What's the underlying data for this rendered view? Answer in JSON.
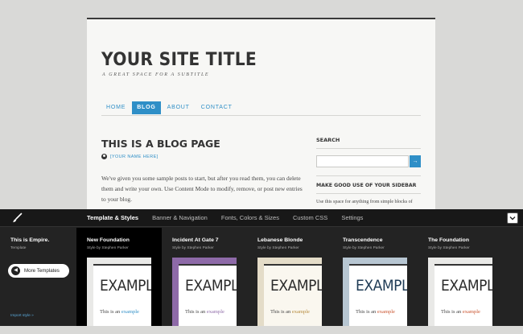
{
  "site": {
    "title": "YOUR SITE TITLE",
    "subtitle": "A GREAT SPACE FOR A SUBTITLE",
    "nav": [
      "HOME",
      "BLOG",
      "ABOUT",
      "CONTACT"
    ],
    "active_nav": "BLOG",
    "post_title": "THIS IS A BLOG PAGE",
    "author": "[YOUR NAME HERE]",
    "post_body": "We've given you some sample posts to start, but after you read them, you can delete them and write your own. Use Content Mode to modify, remove, or post new entries to your blog.",
    "search_label": "SEARCH",
    "search_button": "→",
    "sidebar_heading": "MAKE GOOD USE OF YOUR SIDEBAR",
    "sidebar_text": "Use this space for anything from simple blocks of"
  },
  "editor": {
    "tabs": [
      "Template & Styles",
      "Banner & Navigation",
      "Fonts, Colors & Sizes",
      "Custom CSS",
      "Settings"
    ],
    "active_tab": "Template & Styles",
    "current_template": "This is Empire.",
    "current_template_sub": "Template",
    "more_templates": "More Templates",
    "import_link": "Import style »",
    "templates": [
      {
        "name": "New Foundation",
        "author": "Style by Stephen Parker",
        "big": "EXAMPLE",
        "small": "This is an",
        "small_ex": "example",
        "frame": "#e9e9e7",
        "inner": "#ffffff",
        "big_color": "#2b2b2b",
        "ex_color": "#2f8fc7",
        "selected": true
      },
      {
        "name": "Incident At Gate 7",
        "author": "Style by Stephen Parker",
        "big": "EXAMPLE",
        "small": "This is an",
        "small_ex": "example",
        "frame": "#8e6aa8",
        "inner": "#ffffff",
        "big_color": "#2b2b2b",
        "ex_color": "#8e6aa8",
        "selected": false
      },
      {
        "name": "Lebanese Blonde",
        "author": "Style by Stephen Parker",
        "big": "EXAMPLE",
        "small": "This is an",
        "small_ex": "example",
        "frame": "#e4dcc8",
        "inner": "#faf7ef",
        "big_color": "#2b2b2b",
        "ex_color": "#b58a3c",
        "selected": false
      },
      {
        "name": "Transcendence",
        "author": "Style by Stephen Parker",
        "big": "EXAMPLE",
        "small": "This is an",
        "small_ex": "example",
        "frame": "#b7c6d2",
        "inner": "#ffffff",
        "big_color": "#1f3b55",
        "ex_color": "#c9522d",
        "selected": false
      },
      {
        "name": "The Foundation",
        "author": "Style by Stephen Parker",
        "big": "EXAMPLE",
        "small": "This is an",
        "small_ex": "example",
        "frame": "#e9e9e7",
        "inner": "#ffffff",
        "big_color": "#2b2b2b",
        "ex_color": "#c9522d",
        "selected": false
      }
    ]
  },
  "colors": {
    "accent": "#2f8fc7",
    "panel_bg": "#232323",
    "tabbar_bg": "#181818"
  },
  "icons": {
    "brush": "brush-icon",
    "collapse": "chevron-down-icon",
    "more": "arrow-left-icon"
  }
}
